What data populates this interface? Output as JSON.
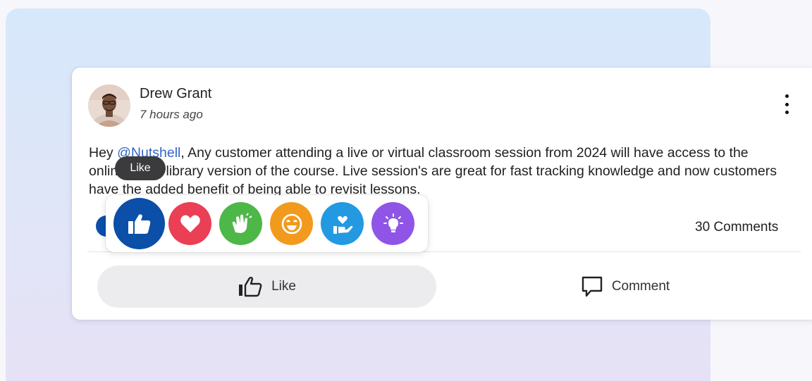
{
  "post": {
    "author": "Drew Grant",
    "time": "7 hours ago",
    "text_parts": {
      "prefix": "Hey ",
      "mention": "@Nutshell",
      "body": ", Any customer attending a live or virtual classroom session from 2024 will have access to the online video library version of the course. Live session's are great for fast tracking knowledge and now customers have the added benefit of being able to revisit lessons."
    },
    "comments_count": "30 Comments"
  },
  "actions": {
    "like_label": "Like",
    "comment_label": "Comment"
  },
  "reactions": {
    "tooltip": "Like",
    "items": [
      {
        "name": "like",
        "icon": "thumbs-up-icon",
        "color": "#0b4fa8"
      },
      {
        "name": "love",
        "icon": "heart-icon",
        "color": "#ea3f55"
      },
      {
        "name": "celebrate",
        "icon": "clapping-hands-icon",
        "color": "#4db748"
      },
      {
        "name": "funny",
        "icon": "laughing-face-icon",
        "color": "#f29a1e"
      },
      {
        "name": "support",
        "icon": "heart-in-hand-icon",
        "color": "#2399e2"
      },
      {
        "name": "insightful",
        "icon": "lightbulb-icon",
        "color": "#8f55e6"
      }
    ]
  },
  "colors": {
    "mention": "#3366c7",
    "tooltip_bg": "#3b3b3d",
    "like_button_bg": "#ececee"
  }
}
